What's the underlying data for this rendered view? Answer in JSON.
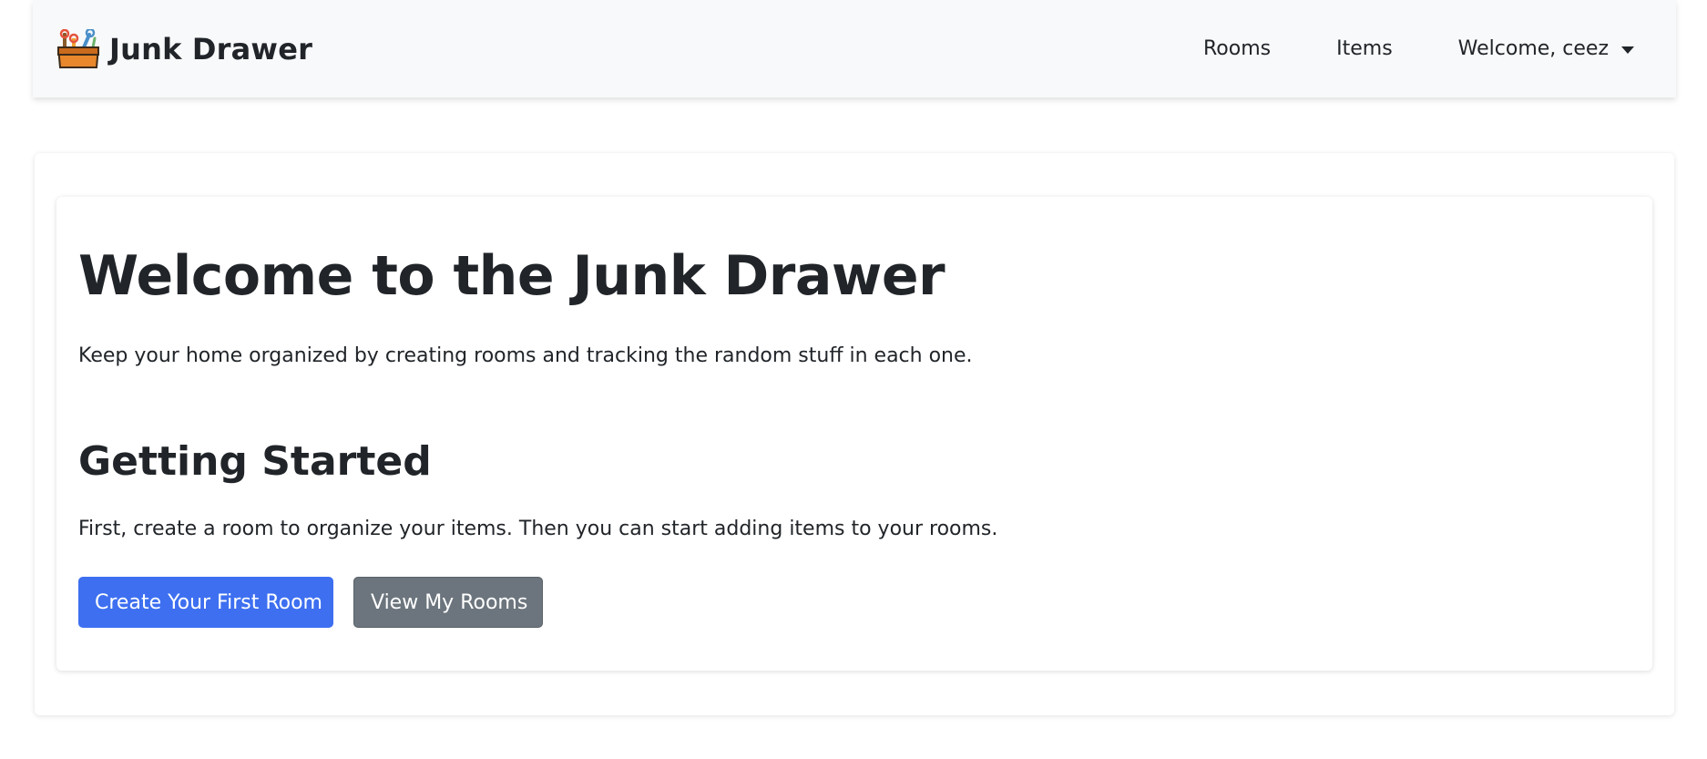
{
  "navbar": {
    "brand": "Junk Drawer",
    "logo_icon": "toolbox-icon",
    "links": [
      {
        "label": "Rooms"
      },
      {
        "label": "Items"
      }
    ],
    "user_menu": {
      "label": "Welcome, ceez"
    }
  },
  "main": {
    "title": "Welcome to the Junk Drawer",
    "lead": "Keep your home organized by creating rooms and tracking the random stuff in each one.",
    "getting_started": {
      "heading": "Getting Started",
      "text": "First, create a room to organize your items. Then you can start adding items to your rooms.",
      "primary_button": "Create Your First Room",
      "secondary_button": "View My Rooms"
    }
  },
  "colors": {
    "primary": "#3d6ff0",
    "secondary": "#6c757d",
    "navbar_bg": "#f8f9fa",
    "text": "#212529"
  }
}
